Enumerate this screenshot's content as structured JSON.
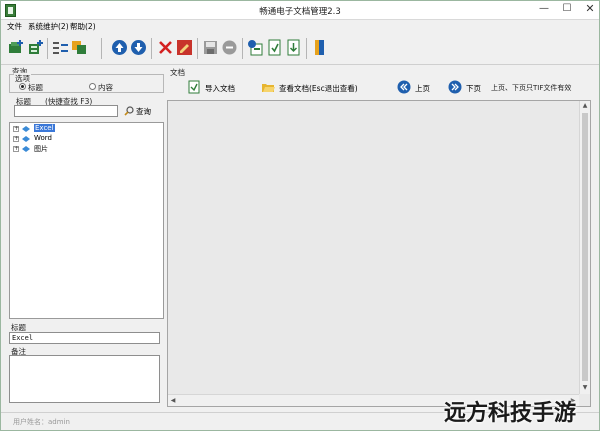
{
  "window": {
    "title": "畅通电子文档管理2.3",
    "controls": [
      "—",
      "☐",
      "✕"
    ]
  },
  "menu": [
    "文件",
    "系统维护(2)",
    "帮助(2)"
  ],
  "toolbar_icons": [
    "add-folder-icon",
    "add-tree-icon",
    "move-icon",
    "copy-icon",
    "move-up-icon",
    "move-down-icon",
    "delete-icon",
    "edit-icon",
    "save-icon",
    "cancel-icon",
    "import-icon",
    "export-icon",
    "export-all-icon",
    "exit-icon"
  ],
  "search": {
    "group_label": "查询",
    "options_label": "选项",
    "radio_title": "标题",
    "radio_content": "内容",
    "title_label": "标题",
    "hint": "(快捷查找 F3)",
    "input_value": "",
    "search_button": "查询"
  },
  "tree": {
    "items": [
      {
        "label": "Excel",
        "selected": true
      },
      {
        "label": "Word",
        "selected": false
      },
      {
        "label": "图片",
        "selected": false
      }
    ]
  },
  "props": {
    "title_label": "标题",
    "title_value": "Excel",
    "note_label": "备注",
    "note_value": ""
  },
  "doc": {
    "group_label": "文档",
    "import_button": "导入文档",
    "view_button": "查看文档(Esc退出查看)",
    "prev_button": "上页",
    "next_button": "下页",
    "page_hint": "上页、下页只TIF文件有效"
  },
  "status": {
    "user": "用户姓名：admin"
  },
  "watermark": "远方科技手游",
  "colors": {
    "accent_blue": "#1f5fae",
    "selection": "#3b78d8",
    "delete_red": "#d42020"
  }
}
